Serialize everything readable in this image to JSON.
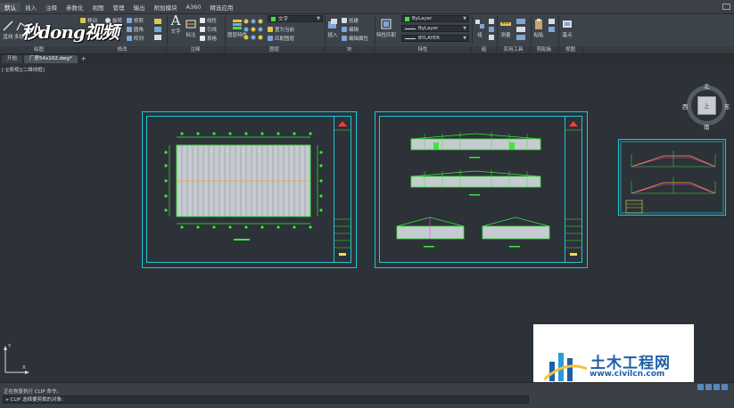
{
  "menubar": {
    "items": [
      "默认",
      "插入",
      "注释",
      "参数化",
      "视图",
      "管理",
      "输出",
      "附加模块",
      "A360",
      "精选应用"
    ],
    "active_index": 0
  },
  "ribbon": {
    "draw_buttons": {
      "line": "直线",
      "polyline": "多段线"
    },
    "modify_items": {
      "move": "移动",
      "rotate": "旋转",
      "trim": "修剪",
      "copy": "复制",
      "fillet": "圆角",
      "array": "阵列"
    },
    "annotation": {
      "text": "文字",
      "dimension": "标注",
      "linear": "线性",
      "leader": "引线",
      "table": "表格"
    },
    "layer_buttons": {
      "properties": "图层特性",
      "make_current": "置为当前",
      "match": "匹配图层"
    },
    "layer_dropdown": "文字",
    "block": {
      "insert": "插入",
      "create": "创建",
      "edit": "编辑",
      "edit_attributes": "编辑属性"
    },
    "properties": {
      "match": "特性匹配",
      "color": "ByLayer",
      "linetype": "ByLayer",
      "lineweight": "BYLAYER"
    },
    "groups_label": "组",
    "utilities": {
      "measure": "测量"
    },
    "clipboard": {
      "paste": "粘贴"
    },
    "view": {
      "base": "基点"
    },
    "group_labels": [
      "绘图",
      "修改",
      "注释",
      "图层",
      "块",
      "特性",
      "组",
      "实用工具",
      "剪贴板",
      "视图"
    ]
  },
  "watermark_top": "秒dong视频",
  "tabs": [
    {
      "label": "开始",
      "active": false
    },
    {
      "label": "厂房54x102.dwg*",
      "active": true
    }
  ],
  "tab_add": "+",
  "viewport_label": "[-][俯视][二维线框]",
  "viewcube": {
    "north": "北",
    "south": "南",
    "east": "东",
    "west": "西",
    "top": "上"
  },
  "ucs": {
    "y": "Y",
    "x": "X"
  },
  "watermark_bottom": {
    "title": "土木工程网",
    "url": "www.civilcn.com"
  },
  "command": {
    "history": "正在恢复执行 CLIP 命令。",
    "prompt": "CLIP 选择要剪裁的对象:"
  },
  "colors": {
    "sheet_border": "#19c8d8",
    "drawing_green": "#3de63d",
    "accent_orange": "#ff9b2a"
  }
}
